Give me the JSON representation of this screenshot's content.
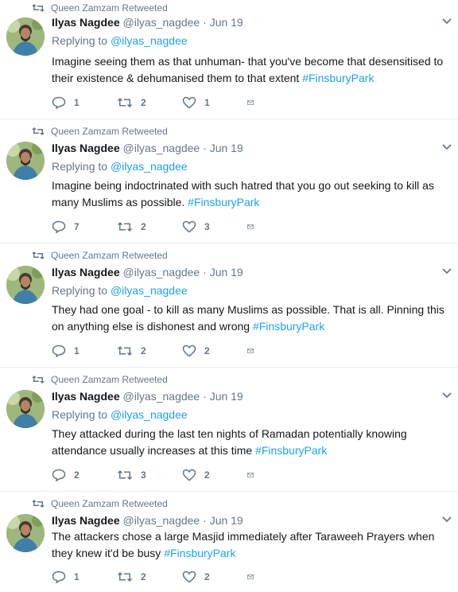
{
  "colors": {
    "link": "#1da1f2",
    "muted": "#657786",
    "divider": "#e6ecf0"
  },
  "icons": {
    "retweet": "retweet-icon",
    "reply": "reply-icon",
    "like": "heart-icon",
    "dm": "envelope-icon",
    "caret": "chevron-down-icon"
  },
  "tweets": [
    {
      "retweeted_by": "Queen Zamzam Retweeted",
      "name": "Ilyas Nagdee",
      "handle": "@ilyas_nagdee",
      "dot": "·",
      "date": "Jun 19",
      "replying_prefix": "Replying to",
      "replying_handle": "@ilyas_nagdee",
      "text": "Imagine seeing them as that unhuman- that you've become that desensitised to their existence & dehumanised them to that extent",
      "hashtag": "#FinsburyPark",
      "replies": "1",
      "retweets": "2",
      "likes": "1"
    },
    {
      "retweeted_by": "Queen Zamzam Retweeted",
      "name": "Ilyas Nagdee",
      "handle": "@ilyas_nagdee",
      "dot": "·",
      "date": "Jun 19",
      "replying_prefix": "Replying to",
      "replying_handle": "@ilyas_nagdee",
      "text": "Imagine being indoctrinated with such hatred that you go out seeking to kill as many Muslims as possible. ",
      "hashtag": "#FinsburyPark",
      "replies": "7",
      "retweets": "2",
      "likes": "3"
    },
    {
      "retweeted_by": "Queen Zamzam Retweeted",
      "name": "Ilyas Nagdee",
      "handle": "@ilyas_nagdee",
      "dot": "·",
      "date": "Jun 19",
      "replying_prefix": "Replying to",
      "replying_handle": "@ilyas_nagdee",
      "text": "They had one goal - to kill as many Muslims as possible. That is all. Pinning this on anything else is dishonest and wrong",
      "hashtag": "#FinsburyPark",
      "replies": "1",
      "retweets": "2",
      "likes": "2"
    },
    {
      "retweeted_by": "Queen Zamzam Retweeted",
      "name": "Ilyas Nagdee",
      "handle": "@ilyas_nagdee",
      "dot": "·",
      "date": "Jun 19",
      "replying_prefix": "Replying to",
      "replying_handle": "@ilyas_nagdee",
      "text": "They attacked during the last ten nights of Ramadan potentially knowing attendance usually increases at this time",
      "hashtag": "#FinsburyPark",
      "replies": "2",
      "retweets": "3",
      "likes": "2"
    },
    {
      "retweeted_by": "Queen Zamzam Retweeted",
      "name": "Ilyas Nagdee",
      "handle": "@ilyas_nagdee",
      "dot": "·",
      "date": "Jun 19",
      "text": "The attackers chose a large Masjid immediately after Taraweeh Prayers when they knew it'd be busy",
      "hashtag": "#FinsburyPark",
      "replies": "1",
      "retweets": "2",
      "likes": "2"
    }
  ]
}
